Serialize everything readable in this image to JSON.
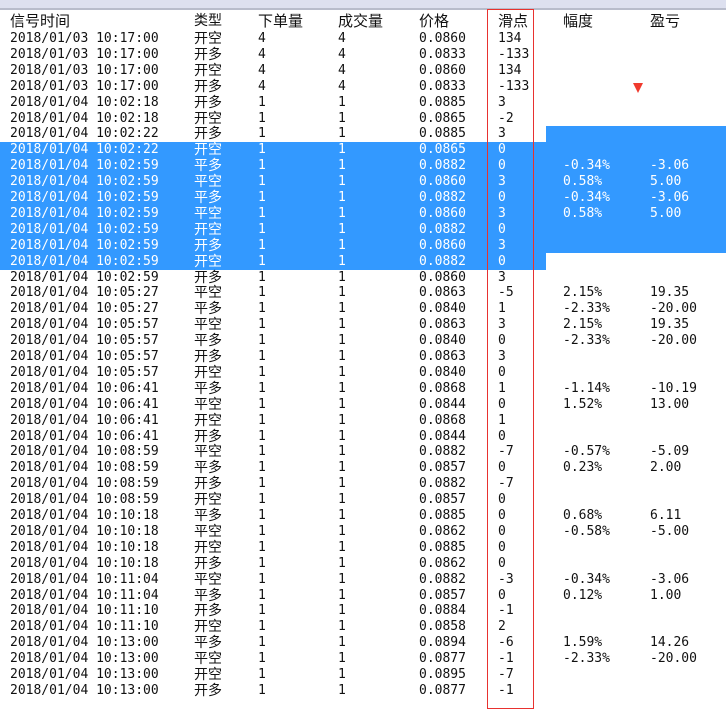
{
  "columns": [
    "信号时间",
    "类型",
    "下单量",
    "成交量",
    "价格",
    "滑点",
    "幅度",
    "盈亏"
  ],
  "selected_rows": [
    7,
    8,
    9,
    10,
    11,
    12,
    13,
    14
  ],
  "colors": {
    "selection": "#3399ff",
    "highlight_box": "#e8322f",
    "arrow": "#f03a2e"
  },
  "rows": [
    [
      "2018/01/03 10:17:00",
      "开空",
      "4",
      "4",
      "0.0860",
      "134",
      "",
      ""
    ],
    [
      "2018/01/03 10:17:00",
      "开多",
      "4",
      "4",
      "0.0833",
      "-133",
      "",
      ""
    ],
    [
      "2018/01/03 10:17:00",
      "开空",
      "4",
      "4",
      "0.0860",
      "134",
      "",
      ""
    ],
    [
      "2018/01/03 10:17:00",
      "开多",
      "4",
      "4",
      "0.0833",
      "-133",
      "",
      ""
    ],
    [
      "2018/01/04 10:02:18",
      "开多",
      "1",
      "1",
      "0.0885",
      "3",
      "",
      ""
    ],
    [
      "2018/01/04 10:02:18",
      "开空",
      "1",
      "1",
      "0.0865",
      "-2",
      "",
      ""
    ],
    [
      "2018/01/04 10:02:22",
      "开多",
      "1",
      "1",
      "0.0885",
      "3",
      "",
      ""
    ],
    [
      "2018/01/04 10:02:22",
      "开空",
      "1",
      "1",
      "0.0865",
      "0",
      "",
      ""
    ],
    [
      "2018/01/04 10:02:59",
      "平多",
      "1",
      "1",
      "0.0882",
      "0",
      "-0.34%",
      "-3.06"
    ],
    [
      "2018/01/04 10:02:59",
      "平空",
      "1",
      "1",
      "0.0860",
      "3",
      "0.58%",
      "5.00"
    ],
    [
      "2018/01/04 10:02:59",
      "平多",
      "1",
      "1",
      "0.0882",
      "0",
      "-0.34%",
      "-3.06"
    ],
    [
      "2018/01/04 10:02:59",
      "平空",
      "1",
      "1",
      "0.0860",
      "3",
      "0.58%",
      "5.00"
    ],
    [
      "2018/01/04 10:02:59",
      "开空",
      "1",
      "1",
      "0.0882",
      "0",
      "",
      ""
    ],
    [
      "2018/01/04 10:02:59",
      "开多",
      "1",
      "1",
      "0.0860",
      "3",
      "",
      ""
    ],
    [
      "2018/01/04 10:02:59",
      "开空",
      "1",
      "1",
      "0.0882",
      "0",
      "",
      ""
    ],
    [
      "2018/01/04 10:02:59",
      "开多",
      "1",
      "1",
      "0.0860",
      "3",
      "",
      ""
    ],
    [
      "2018/01/04 10:05:27",
      "平空",
      "1",
      "1",
      "0.0863",
      "-5",
      "2.15%",
      "19.35"
    ],
    [
      "2018/01/04 10:05:27",
      "平多",
      "1",
      "1",
      "0.0840",
      "1",
      "-2.33%",
      "-20.00"
    ],
    [
      "2018/01/04 10:05:57",
      "平空",
      "1",
      "1",
      "0.0863",
      "3",
      "2.15%",
      "19.35"
    ],
    [
      "2018/01/04 10:05:57",
      "平多",
      "1",
      "1",
      "0.0840",
      "0",
      "-2.33%",
      "-20.00"
    ],
    [
      "2018/01/04 10:05:57",
      "开多",
      "1",
      "1",
      "0.0863",
      "3",
      "",
      ""
    ],
    [
      "2018/01/04 10:05:57",
      "开空",
      "1",
      "1",
      "0.0840",
      "0",
      "",
      ""
    ],
    [
      "2018/01/04 10:06:41",
      "平多",
      "1",
      "1",
      "0.0868",
      "1",
      "-1.14%",
      "-10.19"
    ],
    [
      "2018/01/04 10:06:41",
      "平空",
      "1",
      "1",
      "0.0844",
      "0",
      "1.52%",
      "13.00"
    ],
    [
      "2018/01/04 10:06:41",
      "开空",
      "1",
      "1",
      "0.0868",
      "1",
      "",
      ""
    ],
    [
      "2018/01/04 10:06:41",
      "开多",
      "1",
      "1",
      "0.0844",
      "0",
      "",
      ""
    ],
    [
      "2018/01/04 10:08:59",
      "平空",
      "1",
      "1",
      "0.0882",
      "-7",
      "-0.57%",
      "-5.09"
    ],
    [
      "2018/01/04 10:08:59",
      "平多",
      "1",
      "1",
      "0.0857",
      "0",
      "0.23%",
      "2.00"
    ],
    [
      "2018/01/04 10:08:59",
      "开多",
      "1",
      "1",
      "0.0882",
      "-7",
      "",
      ""
    ],
    [
      "2018/01/04 10:08:59",
      "开空",
      "1",
      "1",
      "0.0857",
      "0",
      "",
      ""
    ],
    [
      "2018/01/04 10:10:18",
      "平多",
      "1",
      "1",
      "0.0885",
      "0",
      "0.68%",
      "6.11"
    ],
    [
      "2018/01/04 10:10:18",
      "平空",
      "1",
      "1",
      "0.0862",
      "0",
      "-0.58%",
      "-5.00"
    ],
    [
      "2018/01/04 10:10:18",
      "开空",
      "1",
      "1",
      "0.0885",
      "0",
      "",
      ""
    ],
    [
      "2018/01/04 10:10:18",
      "开多",
      "1",
      "1",
      "0.0862",
      "0",
      "",
      ""
    ],
    [
      "2018/01/04 10:11:04",
      "平空",
      "1",
      "1",
      "0.0882",
      "-3",
      "-0.34%",
      "-3.06"
    ],
    [
      "2018/01/04 10:11:04",
      "平多",
      "1",
      "1",
      "0.0857",
      "0",
      "0.12%",
      "1.00"
    ],
    [
      "2018/01/04 10:11:10",
      "开多",
      "1",
      "1",
      "0.0884",
      "-1",
      "",
      ""
    ],
    [
      "2018/01/04 10:11:10",
      "开空",
      "1",
      "1",
      "0.0858",
      "2",
      "",
      ""
    ],
    [
      "2018/01/04 10:13:00",
      "平多",
      "1",
      "1",
      "0.0894",
      "-6",
      "1.59%",
      "14.26"
    ],
    [
      "2018/01/04 10:13:00",
      "平空",
      "1",
      "1",
      "0.0877",
      "-1",
      "-2.33%",
      "-20.00"
    ],
    [
      "2018/01/04 10:13:00",
      "开空",
      "1",
      "1",
      "0.0895",
      "-7",
      "",
      ""
    ],
    [
      "2018/01/04 10:13:00",
      "开多",
      "1",
      "1",
      "0.0877",
      "-1",
      "",
      ""
    ]
  ]
}
